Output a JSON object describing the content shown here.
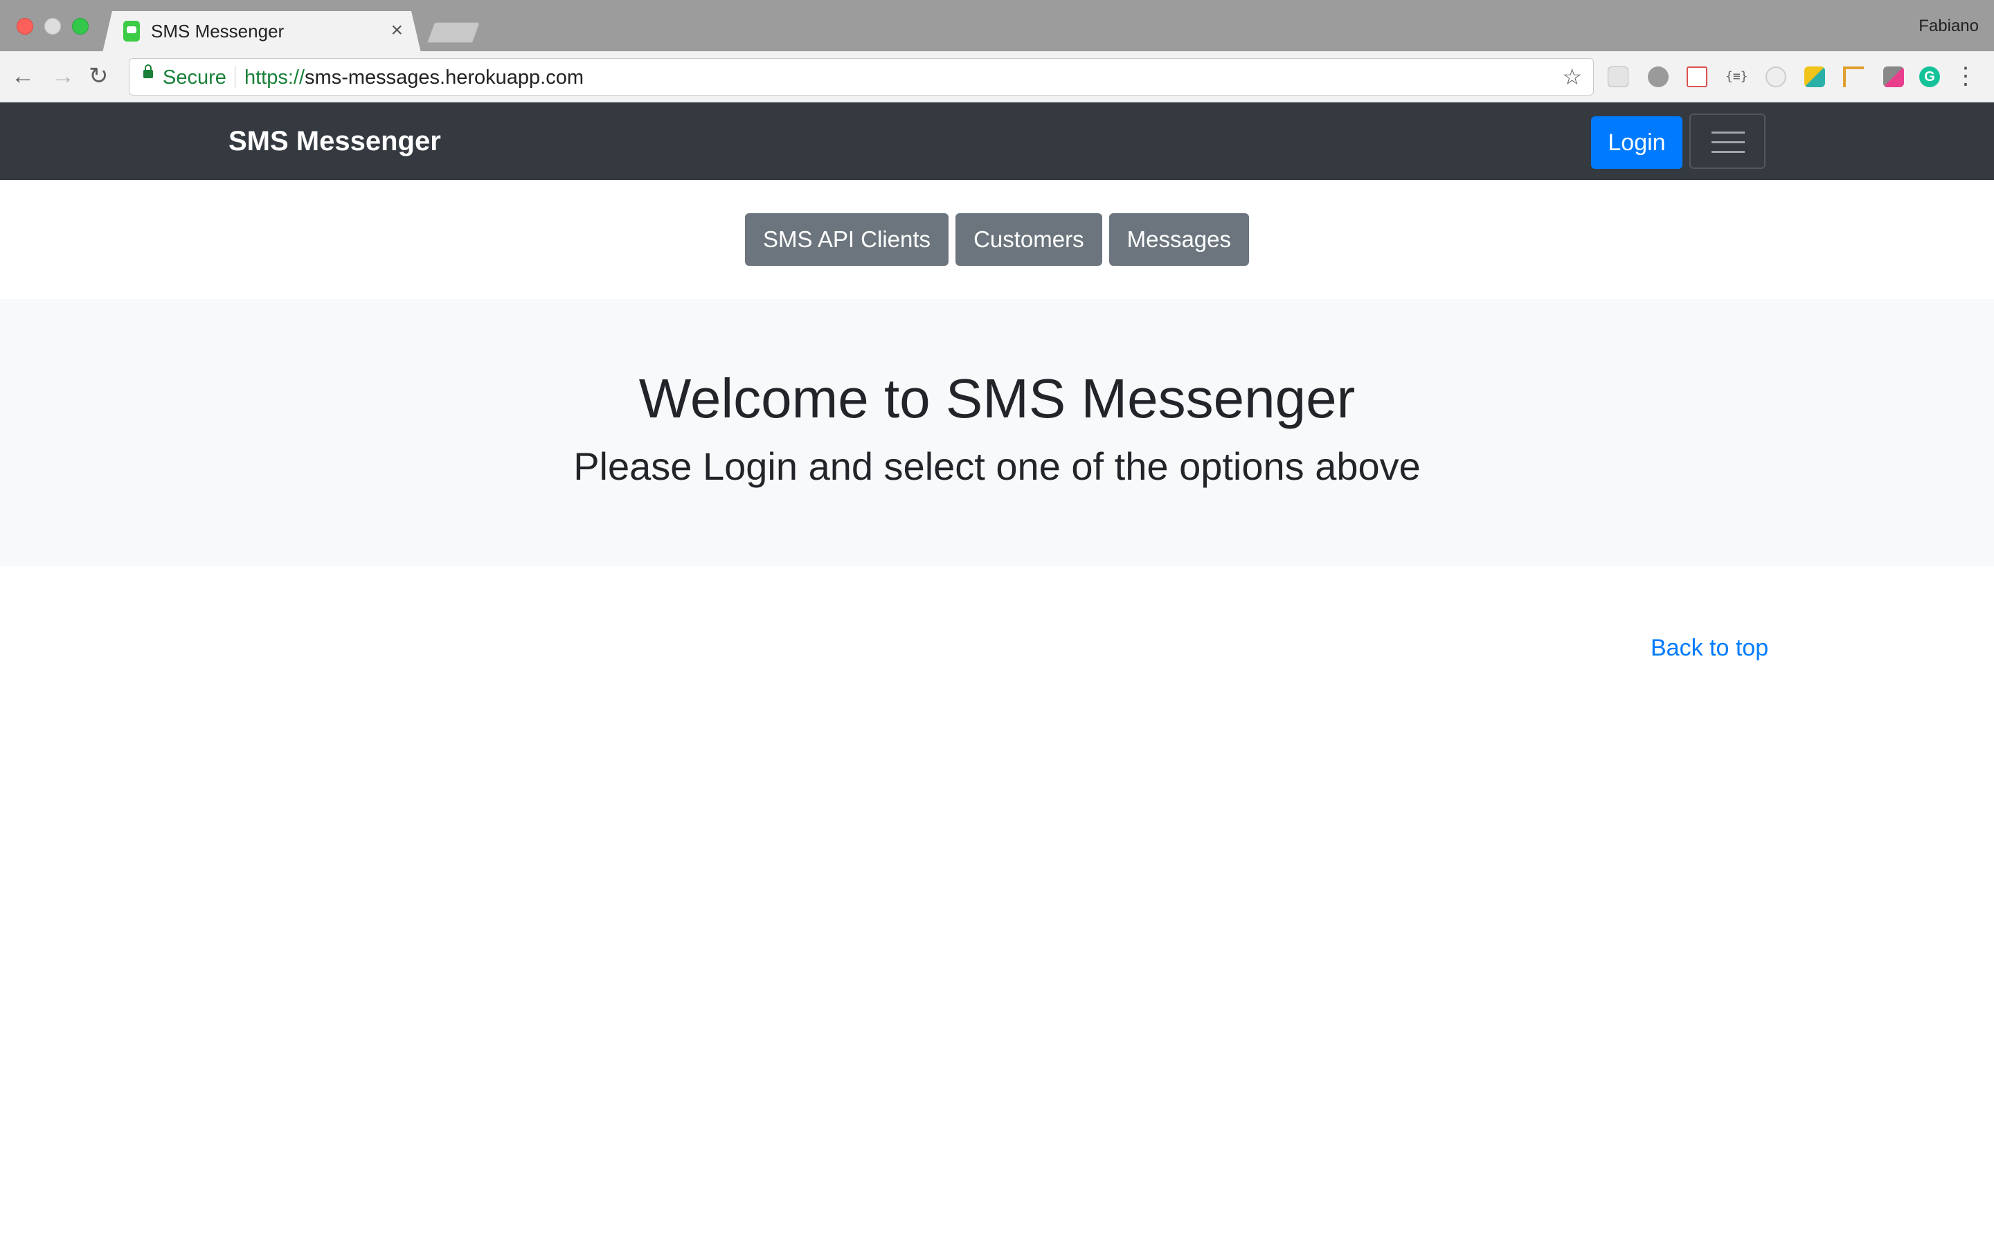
{
  "browser": {
    "tab_title": "SMS Messenger",
    "tab_close": "×",
    "profile_name": "Fabiano",
    "secure_label": "Secure",
    "url_scheme": "https://",
    "url_host": "sms-messages.herokuapp.com"
  },
  "navbar": {
    "brand": "SMS Messenger",
    "login_label": "Login"
  },
  "nav_buttons": [
    "SMS API Clients",
    "Customers",
    "Messages"
  ],
  "jumbotron": {
    "title": "Welcome to SMS Messenger",
    "subtitle": "Please Login and select one of the options above"
  },
  "footer": {
    "back_to_top": "Back to top"
  },
  "colors": {
    "navbar_bg": "#343a40",
    "primary": "#007bff",
    "secondary": "#6c757d",
    "jumbotron_bg": "#f8f9fa"
  }
}
